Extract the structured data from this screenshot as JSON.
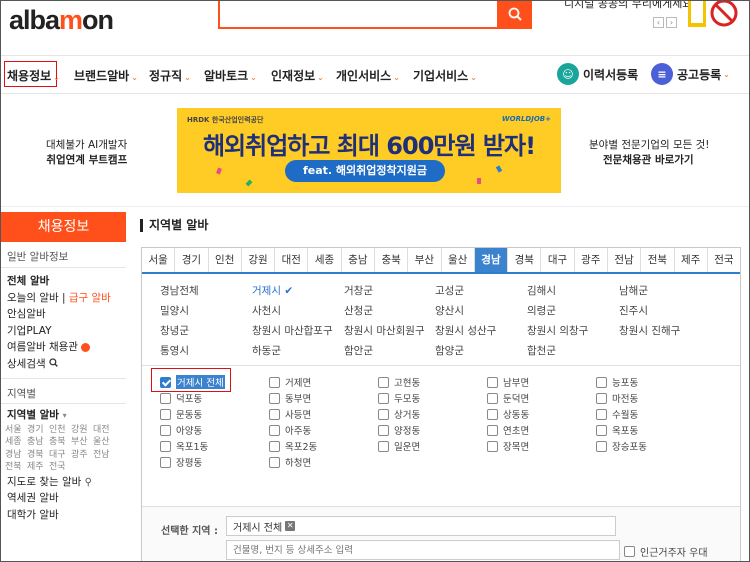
{
  "header": {
    "logo_pre": "alba",
    "logo_o": "m",
    "logo_post": "on",
    "promo_text": "디지털 공공의 무리에게세요!",
    "promo_prev": "‹",
    "promo_next": "›"
  },
  "nav": {
    "items": [
      "채용정보",
      "브랜드알바",
      "정규직",
      "알바토크",
      "인재정보",
      "개인서비스",
      "기업서비스"
    ],
    "resume_label": "이력서등록",
    "post_label": "공고등록"
  },
  "banner": {
    "left_line1": "대체불가 AI개발자",
    "left_line2": "취업연계 부트캠프",
    "hrd": "HRDK 한국산업인력공단",
    "worldjob": "WORLDJOB+",
    "main": "해외취업하고 최대 600만원 받자!",
    "pill": "feat. 해외취업정착지원금",
    "right_line1": "분야별 전문기업의 모든 것!",
    "right_line2": "전문채용관 바로가기"
  },
  "sidebar": {
    "title": "채용정보",
    "head1": "일반 알바정보",
    "items1": [
      "전체 알바",
      "오늘의 알바",
      "급구 알바",
      "안심알바",
      "기업PLAY",
      "여름알바 채용관",
      "상세검색"
    ],
    "head2": "지역별",
    "region_title": "지역별 알바",
    "regions": [
      "서울",
      "경기",
      "인천",
      "강원",
      "대전",
      "세종",
      "충남",
      "충북",
      "부산",
      "울산",
      "경남",
      "경북",
      "대구",
      "광주",
      "전남",
      "전북",
      "제주",
      "전국"
    ],
    "items2": [
      "지도로 찾는 알바",
      "역세권 알바",
      "대학가 알바"
    ]
  },
  "main": {
    "title": "지역별 알바",
    "tabs": [
      "서울",
      "경기",
      "인천",
      "강원",
      "대전",
      "세종",
      "충남",
      "충북",
      "부산",
      "울산",
      "경남",
      "경북",
      "대구",
      "광주",
      "전남",
      "전북",
      "제주",
      "전국"
    ],
    "active_tab": "경남",
    "cities": [
      "경남전체",
      "거제시",
      "거창군",
      "고성군",
      "김해시",
      "남해군",
      "밀양시",
      "사천시",
      "산청군",
      "양산시",
      "의령군",
      "진주시",
      "창녕군",
      "창원시 마산합포구",
      "창원시 마산회원구",
      "창원시 성산구",
      "창원시 의창구",
      "창원시 진해구",
      "통영시",
      "하동군",
      "함안군",
      "함양군",
      "합천군"
    ],
    "active_city": "거제시",
    "dongs": [
      "거제시 전체",
      "거제면",
      "고현동",
      "남부면",
      "능포동",
      "덕포동",
      "동부면",
      "두모동",
      "둔덕면",
      "마전동",
      "문동동",
      "사등면",
      "상거동",
      "상동동",
      "수월동",
      "아양동",
      "아주동",
      "양정동",
      "연초면",
      "옥포동",
      "옥포1동",
      "옥포2동",
      "일운면",
      "장목면",
      "장승포동",
      "장평동",
      "하청면"
    ],
    "selected_label": "선택한 지역 :",
    "selected_value": "거제시 전체",
    "address_placeholder": "건물명, 번지 등 상세주소 입력",
    "nearby_label": "인근거주자 우대"
  }
}
